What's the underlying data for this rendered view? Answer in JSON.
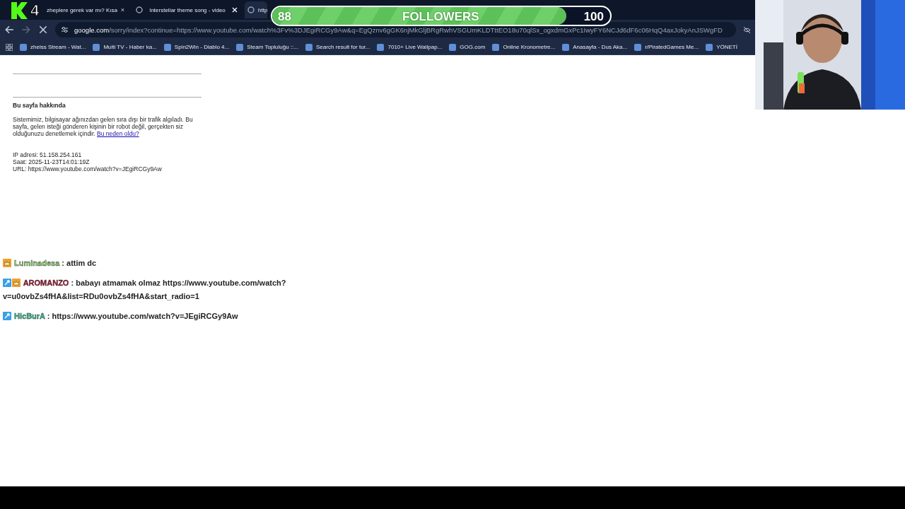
{
  "browser": {
    "tabs": [
      {
        "title": "zheplere gerek var mı? Kısa",
        "selected": false
      },
      {
        "title": "Interstellar theme song - video",
        "selected": false
      },
      {
        "title": "http",
        "selected": true
      }
    ],
    "address": {
      "domain": "google.com",
      "path": "/sorry/index?continue=https://www.youtube.com/watch%3Fv%3DJEgiRCGy9Aw&q=EgQznv6gGK6njMkGljBRgRwhVSGUmKLDTttEO18u70qlSx_ogxdmGxPc1IwyFY6NCJd6dF6c06HqQ4axJokyAnJSWgFD",
      "loading": true
    },
    "bookmarks": [
      {
        "label": "zheiss Stream - Wat..."
      },
      {
        "label": "Multi TV - Haber ka..."
      },
      {
        "label": "Spin2Win - Diablo 4..."
      },
      {
        "label": "Steam Topluluğu ::..."
      },
      {
        "label": "Search result for tur..."
      },
      {
        "label": "7010+ Live Wallpap..."
      },
      {
        "label": "GOG.com"
      },
      {
        "label": "Online Kronometre..."
      },
      {
        "label": "Anasayfa - Dus Aka..."
      },
      {
        "label": "r/PiratedGames Me..."
      },
      {
        "label": "YÖNETİ"
      }
    ]
  },
  "page": {
    "heading": "Bu sayfa hakkında",
    "paragraph": "Sistemimiz, bilgisayar ağınızdan gelen sıra dışı bir trafik algıladı. Bu sayfa, gelen isteği gönderen kişinin bir robot değil, gerçekten siz olduğunuzu denetlemek içindir.",
    "link": "Bu neden oldu?",
    "details": [
      "IP adresi: 51.158.254.161",
      "Saat: 2025-11-23T14:01:19Z",
      "URL: https://www.youtube.com/watch?v=JEgiRCGy9Aw"
    ]
  },
  "overlay": {
    "logo": {
      "number": "4"
    },
    "followers": {
      "current": "88",
      "label": "FOLLOWERS",
      "goal": "100",
      "level": 0.87
    },
    "chat": [
      {
        "user": "Luminadesa",
        "color": "#8fe06a",
        "badges": [
          {
            "kind": "sub"
          }
        ],
        "separator": ":",
        "message": "attim dc"
      },
      {
        "user": "AROMANZO",
        "color": "#a3122f",
        "badges": [
          {
            "kind": "mod"
          },
          {
            "kind": "sub"
          }
        ],
        "separator": ":",
        "message": "babayı atmamak olmaz https://www.youtube.com/watch?v=u0ovbZs4fHA&list=RDu0ovbZs4fHA&start_radio=1"
      },
      {
        "user": "HicBurA",
        "color": "#2bc48f",
        "badges": [
          {
            "kind": "mod"
          }
        ],
        "separator": ":",
        "message": "https://www.youtube.com/watch?v=JEgiRCGy9Aw"
      }
    ]
  }
}
